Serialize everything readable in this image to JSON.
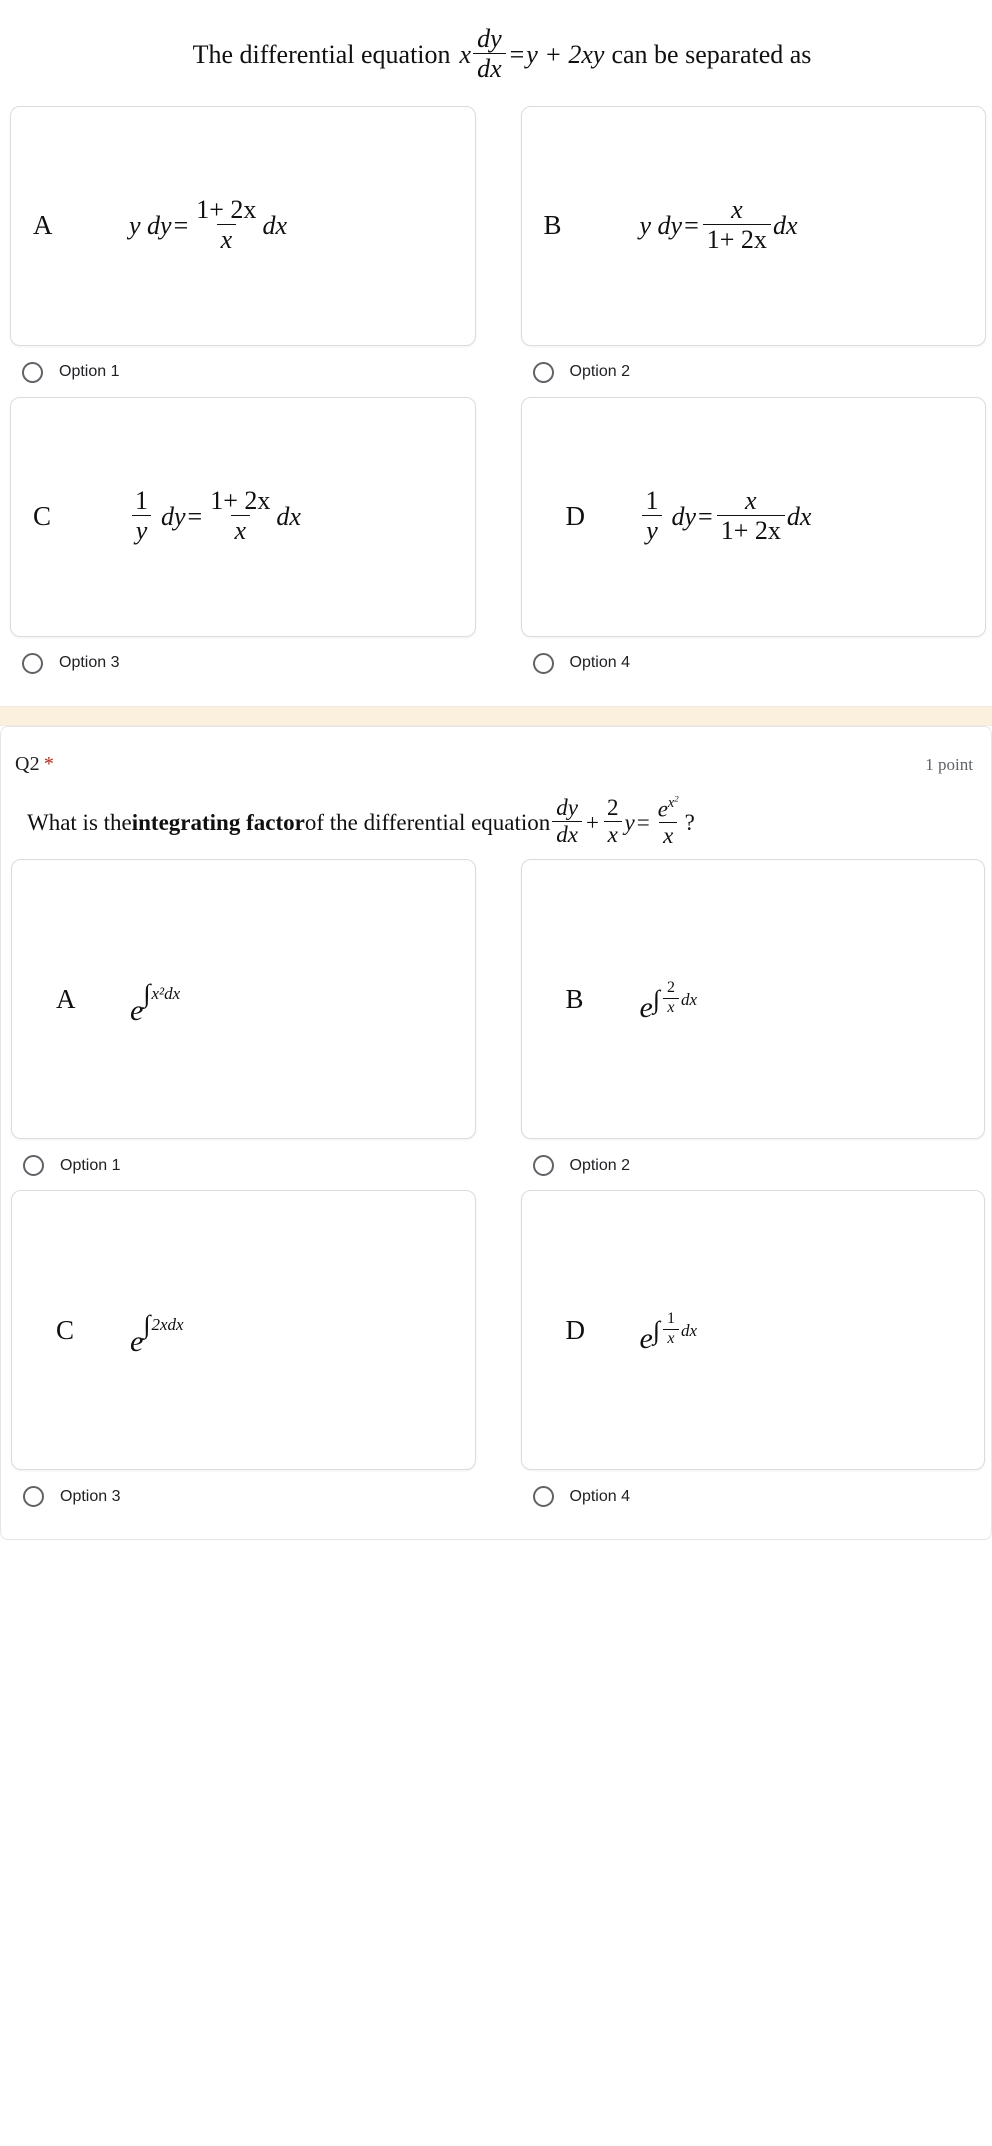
{
  "questions": [
    {
      "id": "q1",
      "label": "",
      "required_marker": "",
      "points": "",
      "prompt_prefix": "The differential equation",
      "prompt_suffix": "can be separated as",
      "equation": {
        "lhs_var": "x",
        "frac_num": "dy",
        "frac_den": "dx",
        "equals": "=",
        "rhs": "y + 2xy"
      },
      "options": [
        {
          "letter": "A",
          "radio_label": "Option 1",
          "math_text": "y dy = (1+2x)/x dx",
          "lhs": "y dy",
          "num": "1+ 2x",
          "den": "x",
          "tail": "dx"
        },
        {
          "letter": "B",
          "radio_label": "Option 2",
          "math_text": "y dy = x/(1+2x) dx",
          "lhs": "y dy",
          "num": "x",
          "den": "1+ 2x",
          "tail": "dx"
        },
        {
          "letter": "C",
          "radio_label": "Option 3",
          "math_text": "(1/y) dy = (1+2x)/x dx",
          "lhs": "dy",
          "lhs_num": "1",
          "lhs_den": "y",
          "num": "1+ 2x",
          "den": "x",
          "tail": "dx"
        },
        {
          "letter": "D",
          "radio_label": "Option 4",
          "math_text": "(1/y) dy = x/(1+2x) dx",
          "lhs": "dy",
          "lhs_num": "1",
          "lhs_den": "y",
          "num": "x",
          "den": "1+ 2x",
          "tail": "dx"
        }
      ]
    },
    {
      "id": "q2",
      "label": "Q2",
      "required_marker": "*",
      "points": "1 point",
      "prompt_prefix": "What is the ",
      "prompt_bold": "integrating factor",
      "prompt_mid": " of the differential equation",
      "prompt_suffix": "?",
      "equation": {
        "frac1_num": "dy",
        "frac1_den": "dx",
        "plus": "+",
        "frac2_num": "2",
        "frac2_den": "x",
        "var": "y",
        "equals": "=",
        "frac3_num": "e",
        "frac3_num_sup": "x",
        "frac3_num_sup2": "2",
        "frac3_den": "x"
      },
      "options": [
        {
          "letter": "A",
          "radio_label": "Option 1",
          "math_text": "e^(∫ x² dx)",
          "base": "e",
          "integrand": "x²",
          "differential": "dx"
        },
        {
          "letter": "B",
          "radio_label": "Option 2",
          "math_text": "e^(∫ (2/x) dx)",
          "base": "e",
          "frac_num": "2",
          "frac_den": "x",
          "differential": "dx"
        },
        {
          "letter": "C",
          "radio_label": "Option 3",
          "math_text": "e^(∫ 2x dx)",
          "base": "e",
          "integrand": "2x",
          "differential": "dx"
        },
        {
          "letter": "D",
          "radio_label": "Option 4",
          "math_text": "e^(∫ (1/x) dx)",
          "base": "e",
          "frac_num": "1",
          "frac_den": "x",
          "differential": "dx"
        }
      ]
    }
  ],
  "colors": {
    "divider_band": "#faf0dd",
    "required_asterisk": "#b3261e",
    "card_border": "#dcdcdc",
    "text": "#101010",
    "muted_text": "#5f6368"
  }
}
